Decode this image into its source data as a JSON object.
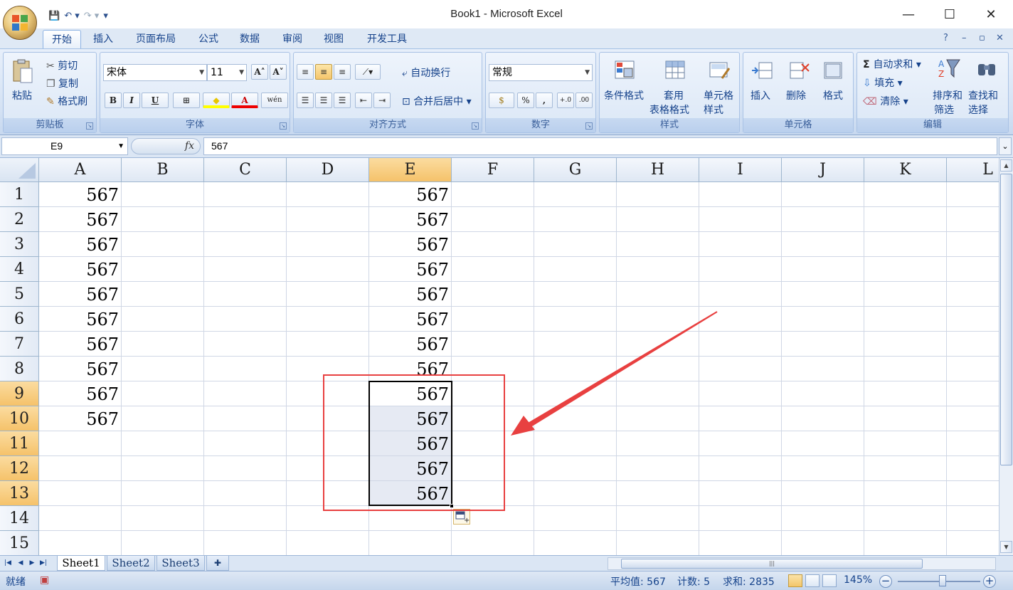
{
  "window": {
    "title": "Book1 - Microsoft Excel",
    "controls": {
      "minimize": "—",
      "maximize": "☐",
      "close": "✕"
    }
  },
  "qat": {
    "save": "💾",
    "undo": "↶ ▾",
    "redo": "↷ ▾",
    "customize": "▾"
  },
  "tabs": [
    "开始",
    "插入",
    "页面布局",
    "公式",
    "数据",
    "审阅",
    "视图",
    "开发工具"
  ],
  "ribbon_right": {
    "help": "?",
    "min": "–",
    "restore": "▫",
    "close": "✕"
  },
  "ribbon": {
    "clipboard": {
      "label": "剪贴板",
      "paste": "粘贴",
      "cut": "剪切",
      "copy": "复制",
      "format_painter": "格式刷"
    },
    "font": {
      "label": "字体",
      "name": "宋体",
      "size": "11",
      "grow": "A˄",
      "shrink": "A˅",
      "bold": "B",
      "italic": "I",
      "underline": "U",
      "border": "⊞",
      "fill": "◆",
      "color": "A",
      "phonetic": "wén"
    },
    "alignment": {
      "label": "对齐方式",
      "wrap": "自动换行",
      "merge": "合并后居中"
    },
    "number": {
      "label": "数字",
      "format": "常规",
      "currency": "$",
      "percent": "%",
      "comma": ",",
      "inc_decimal": "+.0",
      "dec_decimal": ".00"
    },
    "styles": {
      "label": "样式",
      "conditional": "条件格式",
      "table_line1": "套用",
      "table_line2": "表格格式",
      "cell_line1": "单元格",
      "cell_line2": "样式"
    },
    "cells": {
      "label": "单元格",
      "insert": "插入",
      "delete": "删除",
      "format": "格式"
    },
    "editing": {
      "label": "编辑",
      "autosum": "自动求和",
      "fill": "填充",
      "clear": "清除",
      "sort_line1": "排序和",
      "sort_line2": "筛选",
      "find_line1": "查找和",
      "find_line2": "选择"
    }
  },
  "formula_bar": {
    "name_box": "E9",
    "fx": "fx",
    "value": "567"
  },
  "columns": [
    "A",
    "B",
    "C",
    "D",
    "E",
    "F",
    "G",
    "H",
    "I",
    "J",
    "K",
    "L"
  ],
  "selected_column": "E",
  "rows": [
    "1",
    "2",
    "3",
    "4",
    "5",
    "6",
    "7",
    "8",
    "9",
    "10",
    "11",
    "12",
    "13",
    "14",
    "15"
  ],
  "selected_rows": [
    "9",
    "10",
    "11",
    "12",
    "13"
  ],
  "cells": {
    "A": [
      "567",
      "567",
      "567",
      "567",
      "567",
      "567",
      "567",
      "567",
      "567",
      "567"
    ],
    "E": [
      "567",
      "567",
      "567",
      "567",
      "567",
      "567",
      "567",
      "567",
      "567",
      "567",
      "567",
      "567",
      "567"
    ]
  },
  "sheets": [
    "Sheet1",
    "Sheet2",
    "Sheet3"
  ],
  "active_sheet": "Sheet1",
  "status": {
    "ready": "就绪",
    "average": "平均值: 567",
    "count": "计数: 5",
    "sum": "求和: 2835",
    "zoom": "145%"
  },
  "colors": {
    "accent": "#f5c26a",
    "annotation": "#e84040"
  }
}
